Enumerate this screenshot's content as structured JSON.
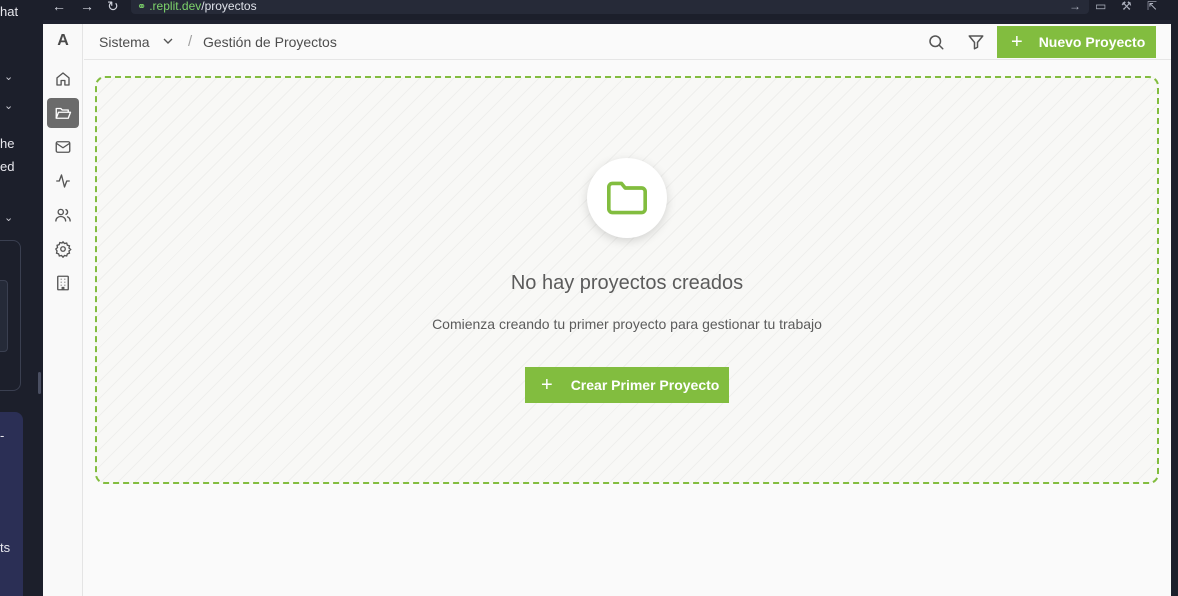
{
  "chat_strip": {
    "fragments": [
      "hat",
      "he",
      "ed",
      "-",
      "ts"
    ]
  },
  "browser": {
    "url_host": ".replit.dev",
    "url_path": "/proyectos"
  },
  "app": {
    "logo": "A",
    "sidebar_icons": [
      "home-icon",
      "folder-icon",
      "mail-icon",
      "activity-icon",
      "users-icon",
      "settings-icon",
      "building-icon"
    ],
    "active_sidebar_item": "folder-icon",
    "breadcrumb": {
      "root": "Sistema",
      "current": "Gestión de Proyectos"
    },
    "header_actions": [
      "search-icon",
      "filter-icon",
      "close-icon"
    ],
    "new_button_label": "Nuevo Proyecto",
    "empty_state": {
      "title": "No hay proyectos creados",
      "subtitle": "Comienza creando tu primer proyecto para gestionar tu trabajo",
      "button_label": "Crear Primer Proyecto"
    }
  },
  "colors": {
    "accent": "#82bd3f",
    "dark_chrome": "#1c1f2b",
    "active_sidebar": "#6b6b6b"
  }
}
